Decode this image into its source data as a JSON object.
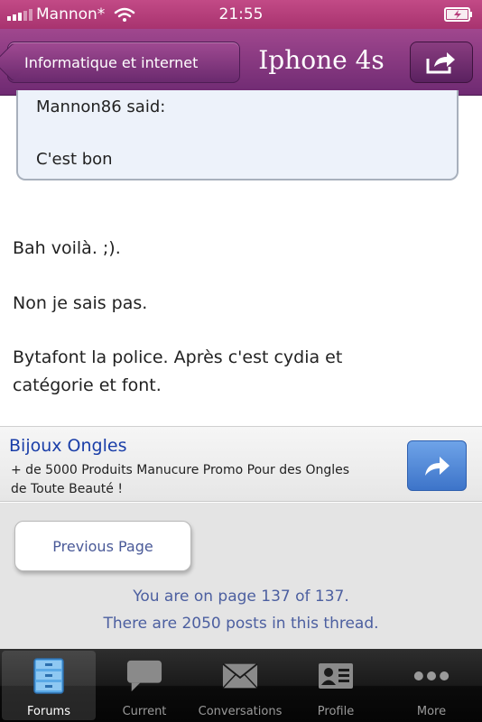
{
  "status_bar": {
    "carrier": "Mannon*",
    "time": "21:55"
  },
  "nav": {
    "back_label": "Informatique et internet",
    "title": "Iphone 4s"
  },
  "quote": {
    "author": "Mannon86 said:",
    "text": "C'est bon"
  },
  "post": {
    "lines": [
      "Bah voilà. ;).",
      "Non je sais pas.",
      "Bytafont la police. Après c'est cydia et",
      "catégorie et font."
    ]
  },
  "ad": {
    "title": "Bijoux Ongles",
    "line1": "+ de 5000 Produits Manucure Promo Pour des Ongles",
    "line2": "de Toute Beauté !"
  },
  "paging": {
    "previous_label": "Previous Page",
    "page_info": "You are on page 137 of 137.",
    "posts_info": "There are 2050 posts in this thread."
  },
  "tabs": [
    {
      "label": "Forums",
      "icon": "forums-icon",
      "active": true
    },
    {
      "label": "Current",
      "icon": "chat-bubble-icon",
      "active": false
    },
    {
      "label": "Conversations",
      "icon": "envelope-icon",
      "active": false
    },
    {
      "label": "Profile",
      "icon": "profile-card-icon",
      "active": false
    },
    {
      "label": "More",
      "icon": "more-dots-icon",
      "active": false
    }
  ],
  "colors": {
    "nav_purple": "#8a3d84",
    "status_pink": "#b83f7e",
    "link_blue": "#1a3ea8",
    "paging_text": "#4c5fa0"
  }
}
